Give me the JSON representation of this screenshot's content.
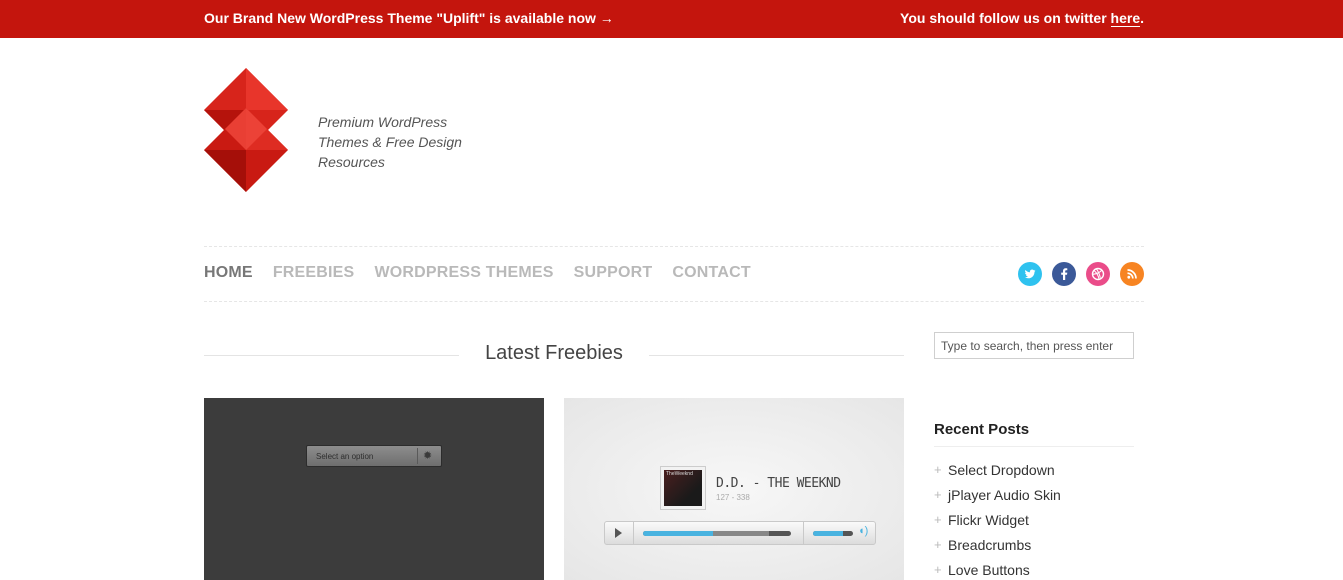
{
  "topbar": {
    "announcement": "Our Brand New WordPress Theme \"Uplift\" is available now →",
    "follow_prefix": "You should follow us on twitter ",
    "follow_link": "here",
    "follow_suffix": "."
  },
  "branding": {
    "tagline_lines": [
      "Premium WordPress",
      "Themes & Free Design",
      "Resources"
    ],
    "brand_color": "#c4150d"
  },
  "nav": {
    "items": [
      {
        "label": "HOME",
        "active": true
      },
      {
        "label": "FREEBIES",
        "active": false
      },
      {
        "label": "WORDPRESS THEMES",
        "active": false
      },
      {
        "label": "SUPPORT",
        "active": false
      },
      {
        "label": "CONTACT",
        "active": false
      }
    ]
  },
  "social": [
    {
      "icon": "twitter-icon",
      "color": "#2fc2ef"
    },
    {
      "icon": "facebook-icon",
      "color": "#3b5998"
    },
    {
      "icon": "dribbble-icon",
      "color": "#ea4c89"
    },
    {
      "icon": "rss-icon",
      "color": "#f78422"
    }
  ],
  "main": {
    "section_title": "Latest Freebies",
    "thumb1": {
      "select_label": "Select an option"
    },
    "thumb2": {
      "cover_label": "TheWeeknd",
      "track_title": "D.D. - THE WEEKND",
      "track_time": "127 - 338",
      "progress_fraction": 0.47,
      "buffer_fraction": 0.85,
      "volume_fraction": 0.75
    }
  },
  "sidebar": {
    "search_placeholder": "Type to search, then press enter",
    "recent_title": "Recent Posts",
    "recent_posts": [
      "Select Dropdown",
      "jPlayer Audio Skin",
      "Flickr Widget",
      "Breadcrumbs",
      "Love Buttons"
    ]
  }
}
